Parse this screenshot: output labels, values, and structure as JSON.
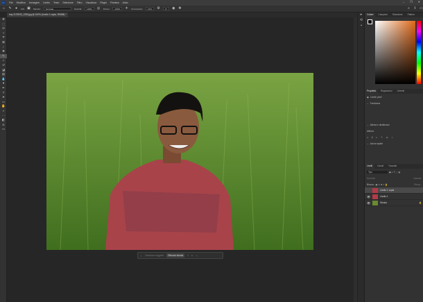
{
  "menu": [
    "File",
    "Modifica",
    "Immagine",
    "Livello",
    "Testo",
    "Selezione",
    "Filtro",
    "Visualizza",
    "Plugin",
    "Finestra",
    "Aiuto"
  ],
  "options": {
    "brush_size": "100",
    "mode_label": "Metodo:",
    "mode": "Normale",
    "opacity_label": "Opacità:",
    "opacity": "100%",
    "flow_label": "Flusso:",
    "flow": "100%",
    "smoothing_label": "Smussatura:",
    "smoothing": "10%",
    "angle": "0°"
  },
  "document_tab": "boy-2176933_1280.jpg @ 100% (Livello 1 copia, RGB/8) *",
  "color_panel": {
    "tabs": [
      "Colore",
      "Campioni",
      "Sfumature",
      "Pattern"
    ],
    "accent": "#e06a1a"
  },
  "properties_panel": {
    "tabs": [
      "Proprietà",
      "Regolazioni",
      "Librerie"
    ],
    "kind": "Livello pixel",
    "transform": "Trasforma",
    "align": "Allinea e distribuisci",
    "align_label": "Allinea:",
    "quick_actions": "Azioni rapide"
  },
  "layers_panel": {
    "tabs": [
      "Livelli",
      "Canali",
      "Tracciati"
    ],
    "filter": "Tipo",
    "blend": "Normale",
    "opacity": "Opacità:",
    "lock": "Blocca:",
    "fill": "Riemp.:",
    "layers": [
      {
        "name": "Livello 1 copia",
        "visible": false,
        "selected": true
      },
      {
        "name": "Livello 1",
        "visible": true,
        "selected": false
      },
      {
        "name": "Sfondo",
        "visible": true,
        "selected": false
      }
    ]
  },
  "context_bar": {
    "select_subject": "Seleziona soggetto",
    "remove_bg": "Rimuovi sfondo"
  }
}
